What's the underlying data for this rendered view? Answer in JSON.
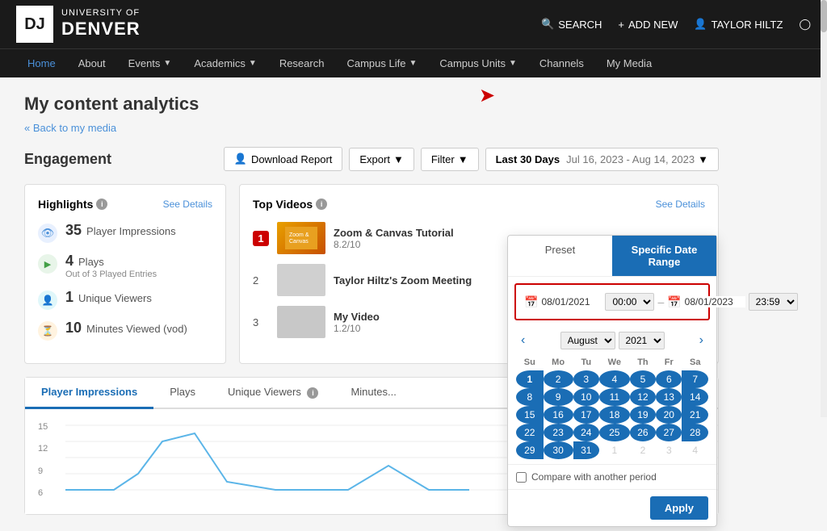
{
  "header": {
    "logo_text_university": "UNIVERSITY OF",
    "logo_text_denver": "DENVER",
    "logo_letters": "DJ",
    "actions": {
      "search_label": "SEARCH",
      "add_new_label": "ADD NEW",
      "user_label": "TAYLOR HILTZ"
    }
  },
  "nav": {
    "items": [
      {
        "label": "Home",
        "active": true,
        "has_arrow": false
      },
      {
        "label": "About",
        "active": false,
        "has_arrow": false
      },
      {
        "label": "Events",
        "active": false,
        "has_arrow": true
      },
      {
        "label": "Academics",
        "active": false,
        "has_arrow": true
      },
      {
        "label": "Research",
        "active": false,
        "has_arrow": false
      },
      {
        "label": "Campus Life",
        "active": false,
        "has_arrow": true
      },
      {
        "label": "Campus Units",
        "active": false,
        "has_arrow": true
      },
      {
        "label": "Channels",
        "active": false,
        "has_arrow": false
      },
      {
        "label": "My Media",
        "active": false,
        "has_arrow": false
      }
    ]
  },
  "page": {
    "title": "My content analytics",
    "back_link": "« Back to my media"
  },
  "engagement": {
    "section_title": "Engagement",
    "download_btn": "Download Report",
    "export_btn": "Export",
    "filter_btn": "Filter",
    "date_range_label": "Last 30 Days",
    "date_range_value": "Jul 16, 2023 - Aug 14, 2023"
  },
  "highlights": {
    "title": "Highlights",
    "see_details": "See Details",
    "stats": [
      {
        "icon_type": "eye",
        "number": "35",
        "label": "Player Impressions",
        "sublabel": ""
      },
      {
        "icon_type": "play",
        "number": "4",
        "label": "Plays",
        "sublabel": "Out of 3 Played Entries"
      },
      {
        "icon_type": "person",
        "number": "1",
        "label": "Unique Viewers",
        "sublabel": ""
      },
      {
        "icon_type": "clock",
        "number": "10",
        "label": "Minutes Viewed (vod)",
        "sublabel": ""
      }
    ]
  },
  "top_videos": {
    "title": "Top Videos",
    "see_details": "See Details",
    "videos": [
      {
        "rank": "1",
        "title": "Zoom & Canvas Tutorial",
        "rating": "8.2/10"
      },
      {
        "rank": "2",
        "title": "Taylor Hiltz's Zoom Meeting",
        "rating": ""
      },
      {
        "rank": "3",
        "title": "My Video",
        "rating": "1.2/10"
      }
    ]
  },
  "chart_tabs": [
    {
      "label": "Player Impressions",
      "active": true
    },
    {
      "label": "Plays",
      "active": false
    },
    {
      "label": "Unique Viewers",
      "active": false,
      "has_info": true
    },
    {
      "label": "Minutes...",
      "active": false
    }
  ],
  "chart": {
    "y_labels": [
      "15",
      "12",
      "9",
      "6"
    ]
  },
  "date_picker": {
    "tab_preset": "Preset",
    "tab_specific": "Specific Date Range",
    "start_date": "08/01/2021",
    "start_time": "00:00",
    "end_date": "08/01/2023",
    "end_time": "23:59",
    "month_select": "August",
    "year_select": "2021",
    "day_headers": [
      "Su",
      "Mo",
      "Tu",
      "We",
      "Th",
      "Fr",
      "Sa"
    ],
    "weeks": [
      [
        "1",
        "2",
        "3",
        "4",
        "5",
        "6",
        "7"
      ],
      [
        "8",
        "9",
        "10",
        "11",
        "12",
        "13",
        "14"
      ],
      [
        "15",
        "16",
        "17",
        "18",
        "19",
        "20",
        "21"
      ],
      [
        "22",
        "23",
        "24",
        "25",
        "26",
        "27",
        "28"
      ],
      [
        "29",
        "30",
        "31",
        "1",
        "2",
        "3",
        "4"
      ]
    ],
    "week_classes": [
      "",
      "",
      "",
      "",
      "last-partial"
    ],
    "compare_label": "Compare with another period",
    "apply_btn": "Apply"
  }
}
